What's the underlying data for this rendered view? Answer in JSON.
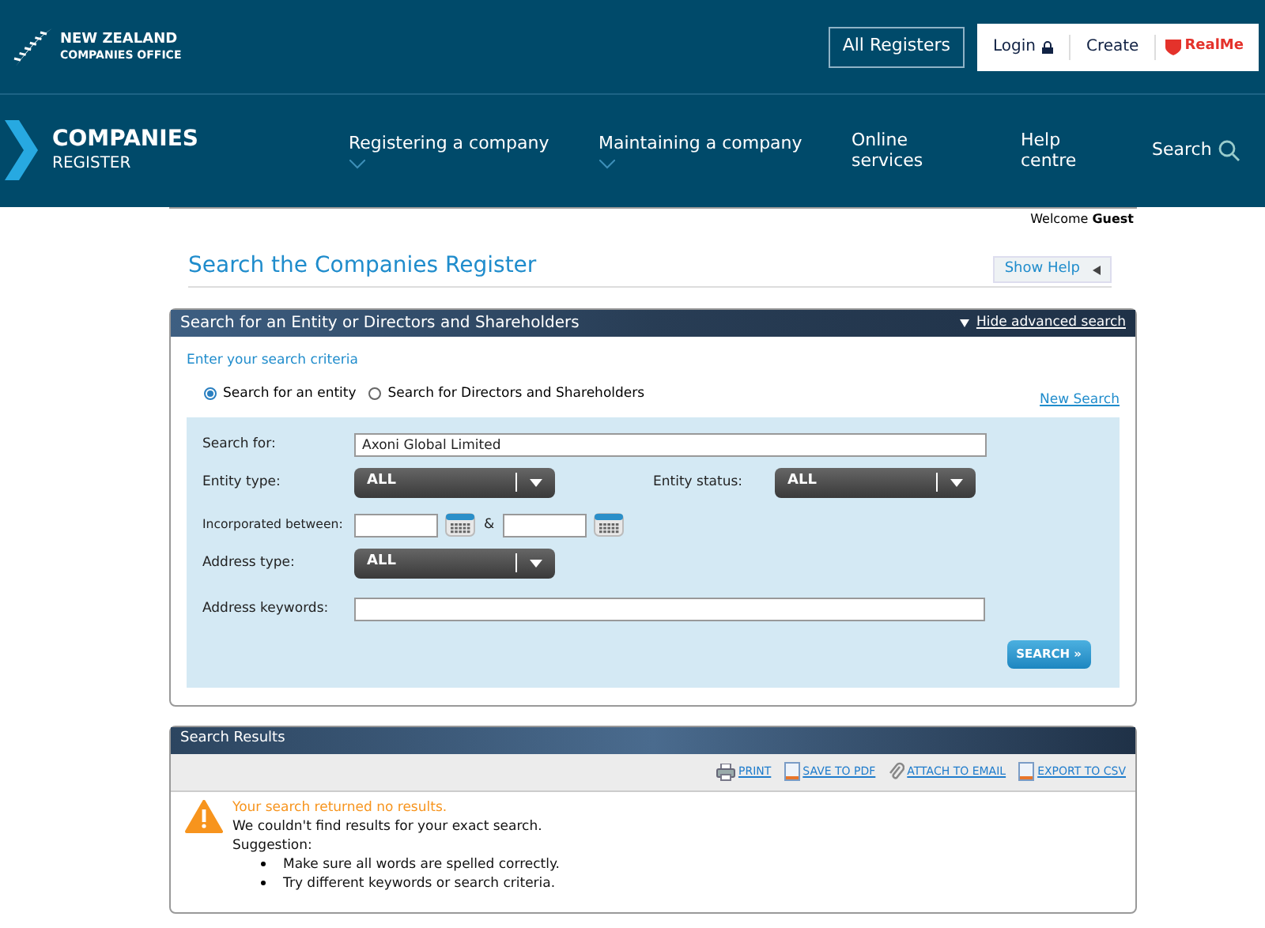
{
  "header": {
    "logo_line1": "NEW ZEALAND",
    "logo_line2": "COMPANIES OFFICE",
    "all_registers": "All Registers",
    "login": "Login",
    "create": "Create",
    "realme": "RealMe"
  },
  "nav": {
    "brand_line1": "COMPANIES",
    "brand_line2": "REGISTER",
    "items": [
      {
        "label": "Registering a company",
        "dropdown": true
      },
      {
        "label": "Maintaining a company",
        "dropdown": true
      },
      {
        "label": "Online services",
        "dropdown": false
      },
      {
        "label": "Help centre",
        "dropdown": false
      }
    ],
    "search": "Search"
  },
  "welcome": {
    "prefix": "Welcome",
    "user": "Guest"
  },
  "page_title": "Search the Companies Register",
  "show_help": "Show Help",
  "search_panel": {
    "title": "Search for an Entity or Directors and Shareholders",
    "toggle": "Hide advanced search",
    "criteria": "Enter your search criteria",
    "modes": [
      {
        "label": "Search for an entity",
        "selected": true
      },
      {
        "label": "Search for Directors and Shareholders",
        "selected": false
      }
    ],
    "new_search": "New Search",
    "search_for": {
      "label": "Search for:",
      "value": "Axoni Global Limited"
    },
    "entity_type": {
      "label": "Entity type:",
      "value": "ALL"
    },
    "entity_status": {
      "label": "Entity status:",
      "value": "ALL"
    },
    "incorporated": {
      "label": "Incorporated between:",
      "joiner": "&"
    },
    "address_type": {
      "label": "Address type:",
      "value": "ALL"
    },
    "address_keywords": {
      "label": "Address keywords:"
    },
    "search_button": "SEARCH »"
  },
  "results": {
    "title": "Search Results",
    "actions": [
      {
        "label": "PRINT",
        "kind": "print"
      },
      {
        "label": "SAVE TO PDF",
        "kind": "doc"
      },
      {
        "label": "ATTACH TO EMAIL",
        "kind": "clip"
      },
      {
        "label": "EXPORT TO CSV",
        "kind": "doc"
      }
    ],
    "warning": "Your search returned no results.",
    "message": "We couldn't find results for your exact search.",
    "suggestion_label": "Suggestion:",
    "suggestions": [
      "Make sure all words are spelled correctly.",
      "Try different keywords or search criteria."
    ]
  }
}
